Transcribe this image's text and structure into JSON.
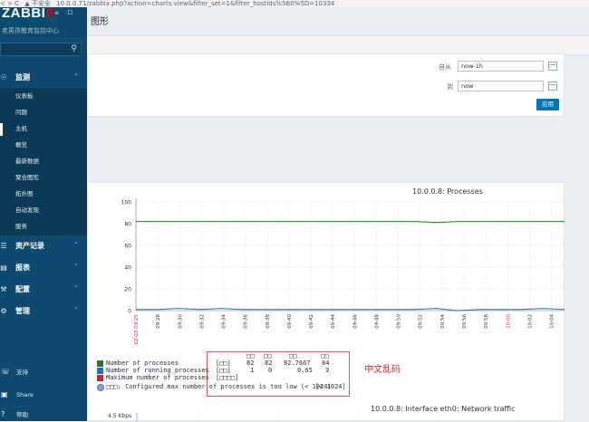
{
  "browser": {
    "nav": "< > C",
    "security": "▲ 不安全",
    "url": "10.0.0.71/zabbix.php?action=charts.view&filter_set=1&filter_hostids%5B0%5D=10334"
  },
  "sidebar": {
    "logo": "ZABBIX",
    "collapse_btn": "«",
    "expand_btn": "▫",
    "subtitle": "老男孩教育监控中心",
    "search_placeholder": "",
    "sections": [
      {
        "label": "监测",
        "icon": "eye-icon",
        "open": true
      },
      {
        "label": "资产记录",
        "icon": "list-icon"
      },
      {
        "label": "报表",
        "icon": "bar-chart-icon"
      },
      {
        "label": "配置",
        "icon": "wrench-icon"
      },
      {
        "label": "管理",
        "icon": "gear-icon"
      }
    ],
    "monitoring_items": [
      "仪表板",
      "问题",
      "主机",
      "概览",
      "最新数据",
      "聚合图形",
      "拓扑图",
      "自动发现",
      "服务"
    ],
    "active_item": "主机",
    "footer": [
      {
        "label": "支持",
        "icon": "support-icon"
      },
      {
        "label": "Share",
        "icon": "share-icon"
      },
      {
        "label": "帮助",
        "icon": "help-icon"
      }
    ]
  },
  "page": {
    "title": "图形"
  },
  "filter": {
    "from_label": "自从",
    "from_value": "now-1h",
    "to_label": "到",
    "to_value": "now",
    "apply_label": "应用"
  },
  "graph1": {
    "title": "10.0.0.8: Processes",
    "annotation": "中文乱码",
    "legend": {
      "headers": [
        "□□",
        "□□",
        "□□",
        "□□"
      ],
      "rows": [
        {
          "name": "Number of processes",
          "unit": "[□□]",
          "values": [
            "82",
            "82",
            "82.7667",
            "84"
          ],
          "color": "#1a7f1a"
        },
        {
          "name": "Number of running processes",
          "unit": "[□□]",
          "values": [
            "1",
            "0",
            "0.65",
            "3"
          ],
          "color": "#1e6fb8"
        },
        {
          "name": "Maximum number of processes",
          "unit": "[□□□□]",
          "values": [
            "",
            "",
            "",
            ""
          ],
          "color": "#cc2222"
        }
      ],
      "trigger": "□□□: Configured max number of processes is too low (< 1024)",
      "trigger_value": "[< 1024]"
    }
  },
  "graph2": {
    "title": "10.0.0.8: Interface eth0: Network traffic",
    "y_top_label": "4.5 Kbps"
  },
  "chart_data": {
    "type": "line",
    "title": "10.0.0.8: Processes",
    "ylim": [
      0,
      100
    ],
    "y_ticks": [
      0,
      20,
      40,
      60,
      80,
      100
    ],
    "x_labels": [
      "02-03 09:25",
      "09:28",
      "09:30",
      "09:32",
      "09:34",
      "09:36",
      "09:38",
      "09:40",
      "09:42",
      "09:44",
      "09:46",
      "09:48",
      "09:50",
      "09:52",
      "09:54",
      "09:56",
      "09:58",
      "10:00",
      "10:02",
      "10:04"
    ],
    "x_label_colors": {
      "02-03 09:25": "#dd2222",
      "10:00": "#dd2222"
    },
    "grid": true,
    "series": [
      {
        "name": "Number of processes",
        "color": "#1a7f1a",
        "values": [
          82,
          82,
          82,
          82,
          82,
          82,
          82,
          82,
          82,
          82,
          82,
          82,
          82,
          82,
          81,
          82,
          82,
          82,
          82,
          82,
          82
        ]
      },
      {
        "name": "Number of running processes",
        "color": "#1e6fb8",
        "values": [
          1,
          1,
          2,
          1,
          2,
          1,
          1,
          1,
          1,
          1,
          1,
          1,
          1,
          1,
          2,
          0,
          1,
          1,
          1,
          2,
          1
        ]
      }
    ]
  }
}
